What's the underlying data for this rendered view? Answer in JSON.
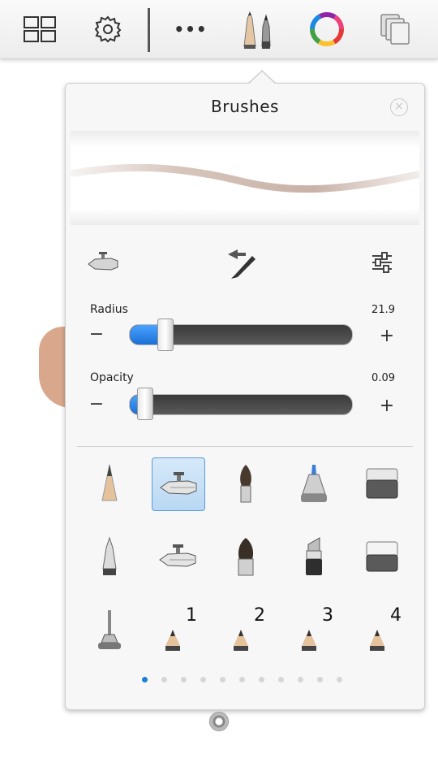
{
  "toolbar": {
    "icons": [
      "layout-grid-icon",
      "gear-icon",
      "more-dots-icon",
      "brushes-icon",
      "color-wheel-icon",
      "layers-icon"
    ],
    "more_label": "•••"
  },
  "panel": {
    "title": "Brushes",
    "close_label": "×",
    "tool_icons": [
      "airbrush-icon",
      "swap-brush-icon",
      "brush-settings-icon"
    ],
    "radius": {
      "label": "Radius",
      "value": "21.9",
      "fraction": 0.12
    },
    "opacity": {
      "label": "Opacity",
      "value": "0.09",
      "fraction": 0.03
    },
    "minus_label": "−",
    "plus_label": "+",
    "brushes": [
      [
        "pencil-icon",
        "airbrush-icon",
        "paintbrush-icon",
        "marker-icon",
        "eraser-icon"
      ],
      [
        "ballpoint-pen-icon",
        "airbrush-2-icon",
        "flat-brush-icon",
        "chisel-marker-icon",
        "hard-eraser-icon"
      ],
      [
        "smudge-tool-icon",
        "custom-brush-icon",
        "custom-brush-icon",
        "custom-brush-icon",
        "custom-brush-icon"
      ]
    ],
    "selected_brush": "airbrush-icon",
    "custom_labels": [
      "1",
      "2",
      "3",
      "4"
    ],
    "page_count": 11,
    "current_page": 1
  },
  "colors": {
    "accent": "#1e7fd8",
    "selection": "#b9d8f3"
  }
}
